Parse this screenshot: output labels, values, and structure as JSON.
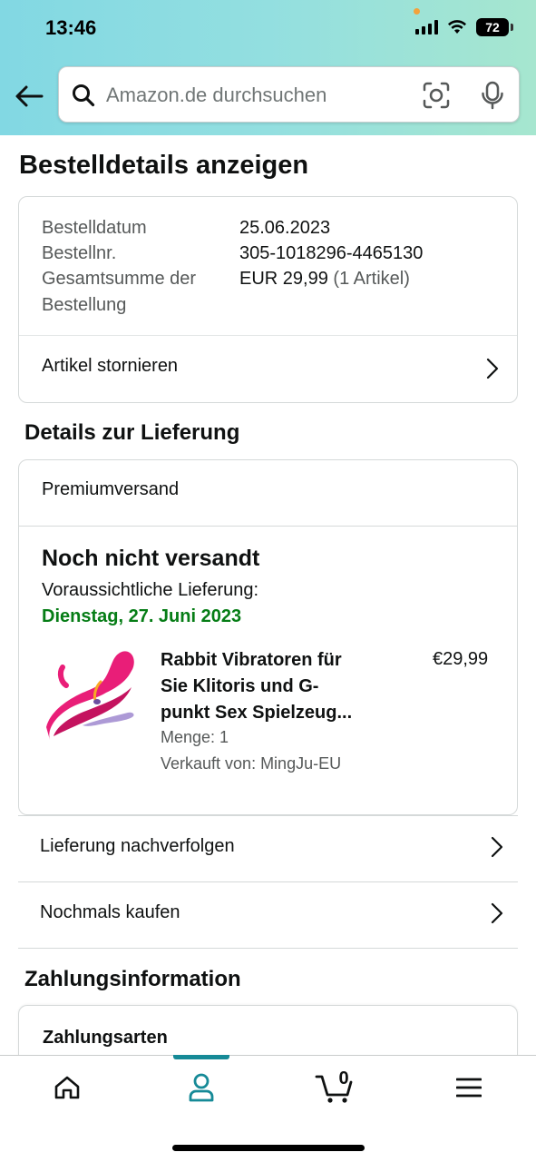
{
  "status_bar": {
    "time": "13:46",
    "battery": "72",
    "icons": [
      "signal-icon",
      "wifi-icon",
      "battery-icon"
    ]
  },
  "search": {
    "placeholder": "Amazon.de durchsuchen",
    "icons": [
      "back-arrow-icon",
      "search-icon",
      "camera-scan-icon",
      "microphone-icon"
    ]
  },
  "page": {
    "title": "Bestelldetails anzeigen"
  },
  "order": {
    "date_label": "Bestelldatum",
    "date_value": "25.06.2023",
    "number_label": "Bestellnr.",
    "number_value": "305-1018296-4465130",
    "total_label_line1": "Gesamtsumme der",
    "total_label_line2": "Bestellung",
    "total_value": "EUR 29,99",
    "total_items": "(1 Artikel)",
    "cancel_label": "Artikel stornieren"
  },
  "delivery": {
    "section_title": "Details zur Lieferung",
    "shipping_method": "Premiumversand",
    "status": "Noch nicht versandt",
    "estimated_label": "Voraussichtliche Lieferung:",
    "estimated_date": "Dienstag, 27. Juni 2023",
    "product": {
      "title_line1": "Rabbit Vibratoren für",
      "title_line2": "Sie Klitoris und G-",
      "title_line3": "punkt Sex Spielzeug...",
      "price": "€29,99",
      "quantity": "Menge: 1",
      "seller": "Verkauft von: MingJu-EU"
    },
    "track_label": "Lieferung nachverfolgen",
    "buy_again_label": "Nochmals kaufen"
  },
  "payment": {
    "section_title": "Zahlungsinformation",
    "methods_label": "Zahlungsarten"
  },
  "tabbar": {
    "tabs": [
      "home-icon",
      "account-icon",
      "cart-icon",
      "menu-icon"
    ],
    "active_tab": "account-icon",
    "cart_count": "0",
    "accent_color": "#168a97"
  },
  "colors": {
    "delivery_green": "#067d16",
    "header_gradient_start": "#82d8e3",
    "header_gradient_end": "#a6e6cf"
  }
}
